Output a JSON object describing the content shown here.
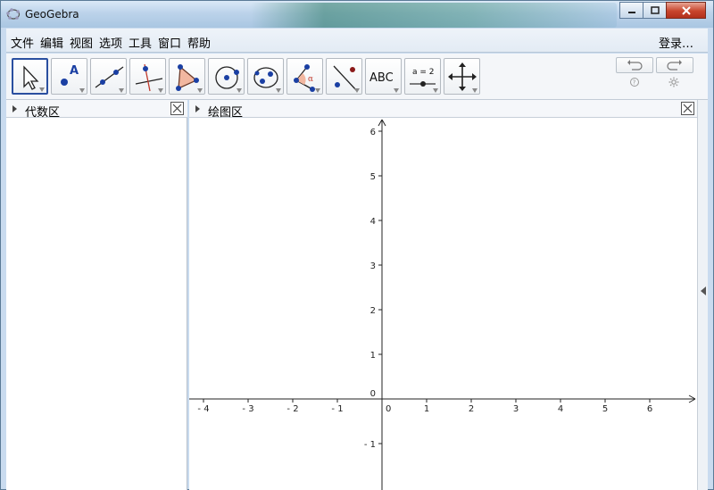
{
  "window": {
    "title": "GeoGebra",
    "minimize_icon": "minimize-icon",
    "maximize_icon": "maximize-icon",
    "close_icon": "close-icon"
  },
  "menu": {
    "items": [
      "文件",
      "编辑",
      "视图",
      "选项",
      "工具",
      "窗口",
      "帮助"
    ],
    "login": "登录…"
  },
  "toolbar": {
    "tools": [
      {
        "name": "move",
        "icon": "pointer-arrow-icon"
      },
      {
        "name": "point",
        "icon": "point-icon",
        "label": "A"
      },
      {
        "name": "line",
        "icon": "line-through-points-icon"
      },
      {
        "name": "perpendicular",
        "icon": "perpendicular-line-icon"
      },
      {
        "name": "polygon",
        "icon": "polygon-icon"
      },
      {
        "name": "circle",
        "icon": "circle-center-point-icon"
      },
      {
        "name": "ellipse",
        "icon": "ellipse-icon"
      },
      {
        "name": "angle",
        "icon": "angle-icon",
        "label": "α"
      },
      {
        "name": "reflect",
        "icon": "reflect-about-line-icon"
      },
      {
        "name": "text",
        "icon": "text-icon",
        "label": "ABC"
      },
      {
        "name": "slider",
        "icon": "slider-icon",
        "label": "a = 2"
      },
      {
        "name": "move-graphics",
        "icon": "move-graphics-view-icon"
      }
    ],
    "undo_icon": "undo-icon",
    "redo_icon": "redo-icon",
    "help_icon": "help-icon",
    "settings_icon": "settings-gear-icon"
  },
  "algebra_view": {
    "title": "代数区"
  },
  "graphics_view": {
    "title": "绘图区",
    "x_tick_labels": [
      "- 4",
      "- 3",
      "- 2",
      "- 1",
      "0",
      "1",
      "2",
      "3",
      "4",
      "5",
      "6"
    ],
    "y_tick_labels": [
      "6",
      "5",
      "4",
      "3",
      "2",
      "1",
      "- 1"
    ],
    "x_range": [
      -4.3,
      7.1
    ],
    "y_range": [
      -1.6,
      6.3
    ]
  },
  "colors": {
    "title_bar": "#bcd3ea",
    "close_button": "#c8452d",
    "active_tool_border": "#2a4fa0",
    "point_blue": "#1a3fa3",
    "accent_red": "#c0392b"
  }
}
